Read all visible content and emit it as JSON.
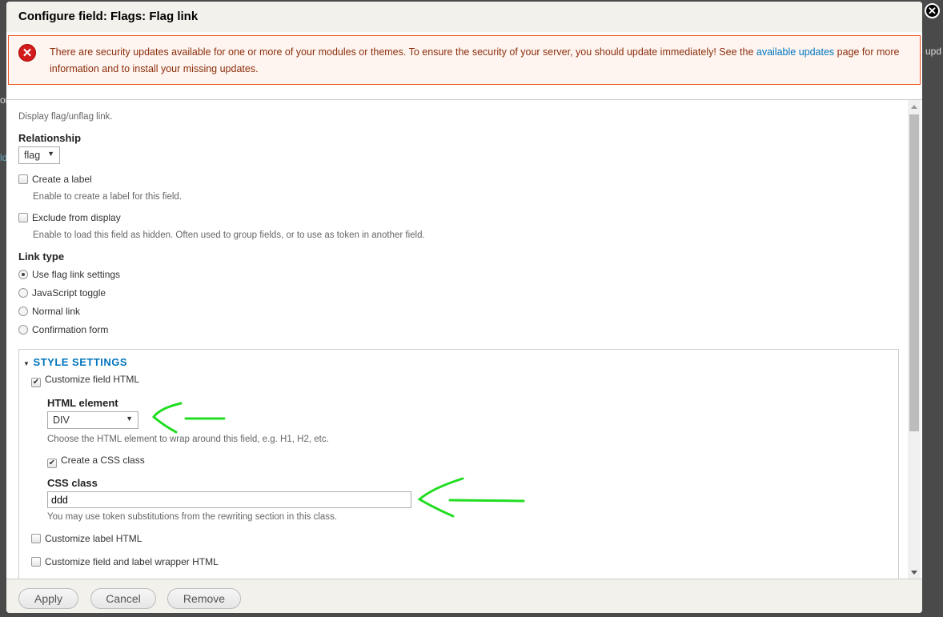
{
  "background": {
    "snippets": [
      "or",
      "ld",
      "upd"
    ]
  },
  "dialog": {
    "title": "Configure field: Flags: Flag link",
    "close_icon": "close-circle-icon"
  },
  "message": {
    "type": "error",
    "icon": "error-icon",
    "text_before": "There are security updates available for one or more of your modules or themes. To ensure the security of your server, you should update immediately! See the ",
    "link": "available updates",
    "text_after": " page for more information and to install your missing updates."
  },
  "form": {
    "description": "Display flag/unflag link.",
    "relationship": {
      "label": "Relationship",
      "value": "flag"
    },
    "create_label": {
      "label": "Create a label",
      "checked": false,
      "description": "Enable to create a label for this field."
    },
    "exclude": {
      "label": "Exclude from display",
      "checked": false,
      "description": "Enable to load this field as hidden. Often used to group fields, or to use as token in another field."
    },
    "link_type": {
      "label": "Link type",
      "options": [
        "Use flag link settings",
        "JavaScript toggle",
        "Normal link",
        "Confirmation form"
      ],
      "selected": "Use flag link settings"
    },
    "style": {
      "title": "STYLE SETTINGS",
      "customize_field": {
        "label": "Customize field HTML",
        "checked": true
      },
      "html_element": {
        "label": "HTML element",
        "value": "DIV",
        "description": "Choose the HTML element to wrap around this field, e.g. H1, H2, etc."
      },
      "create_css": {
        "label": "Create a CSS class",
        "checked": true
      },
      "css_class": {
        "label": "CSS class",
        "value": "ddd",
        "description": "You may use token substitutions from the rewriting section in this class."
      },
      "customize_label": {
        "label": "Customize label HTML",
        "checked": false
      },
      "customize_wrapper": {
        "label": "Customize field and label wrapper HTML",
        "checked": false
      }
    }
  },
  "buttons": {
    "apply": "Apply",
    "cancel": "Cancel",
    "remove": "Remove"
  },
  "annotation_color": "#22dd22"
}
